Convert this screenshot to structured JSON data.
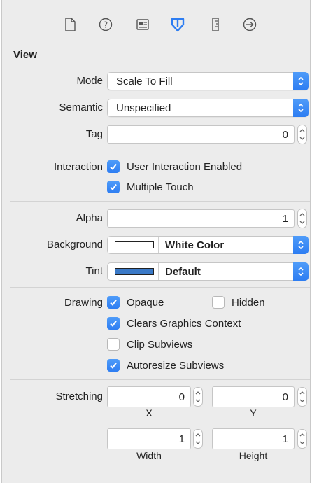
{
  "toolbar": {
    "icons": [
      "file-inspector-icon",
      "quick-help-icon",
      "identity-inspector-icon",
      "attributes-inspector-icon",
      "size-inspector-icon",
      "connections-inspector-icon"
    ],
    "accent": "#2d7df2"
  },
  "section": {
    "title": "View"
  },
  "mode": {
    "label": "Mode",
    "value": "Scale To Fill"
  },
  "semantic": {
    "label": "Semantic",
    "value": "Unspecified"
  },
  "tag": {
    "label": "Tag",
    "value": "0"
  },
  "interaction": {
    "label": "Interaction",
    "user_interaction": {
      "label": "User Interaction Enabled",
      "checked": true
    },
    "multiple_touch": {
      "label": "Multiple Touch",
      "checked": true
    }
  },
  "alpha": {
    "label": "Alpha",
    "value": "1"
  },
  "background": {
    "label": "Background",
    "value": "White Color",
    "swatch": "#ffffff"
  },
  "tint": {
    "label": "Tint",
    "value": "Default",
    "swatch": "#3a79c7"
  },
  "drawing": {
    "label": "Drawing",
    "opaque": {
      "label": "Opaque",
      "checked": true
    },
    "hidden": {
      "label": "Hidden",
      "checked": false
    },
    "clears_graphics": {
      "label": "Clears Graphics Context",
      "checked": true
    },
    "clip_subviews": {
      "label": "Clip Subviews",
      "checked": false
    },
    "autoresize": {
      "label": "Autoresize Subviews",
      "checked": true
    }
  },
  "stretching": {
    "label": "Stretching",
    "x": {
      "value": "0",
      "caption": "X"
    },
    "y": {
      "value": "0",
      "caption": "Y"
    },
    "width": {
      "value": "1",
      "caption": "Width"
    },
    "height": {
      "value": "1",
      "caption": "Height"
    }
  }
}
